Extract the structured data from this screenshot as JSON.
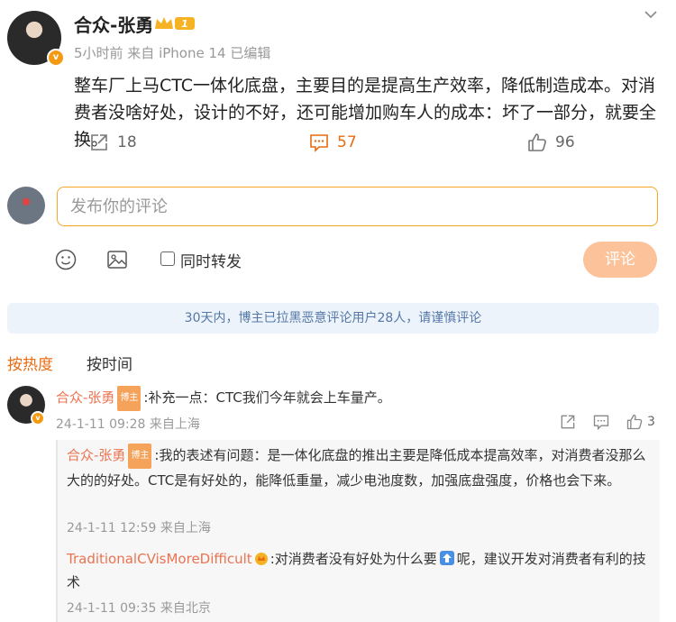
{
  "post": {
    "author": "合众-张勇",
    "level_badge": "1",
    "meta": "5小时前  来自 iPhone 14 已编辑",
    "text": "整车厂上马CTC一体化底盘，主要目的是提高生产效率，降低制造成本。对消费者没啥好处，设计的不好，还可能增加购车人的成本：坏了一部分，就要全换。",
    "shares": "18",
    "comments": "57",
    "likes": "96"
  },
  "composer": {
    "placeholder": "发布你的评论",
    "repost_label": "同时转发",
    "submit_label": "评论"
  },
  "notice": "30天内，博主已拉黑恶意评论用户28人，请谨慎评论",
  "sort": {
    "hot": "按热度",
    "time": "按时间"
  },
  "comment": {
    "name": "合众-张勇",
    "tag": "博主",
    "text": ":补充一点：CTC我们今年就会上车量产。",
    "meta": "24-1-11 09:28 来自上海",
    "likes": "3"
  },
  "replies": [
    {
      "name": "合众-张勇",
      "tag": "博主",
      "text": ":我的表述有问题：是一体化底盘的推出主要是降低成本提高效率，对消费者没那么大的的好处。CTC是有好处的，能降低重量，减少电池度数，加强底盘强度，价格也会下来。",
      "meta": "24-1-11 12:59 来自上海"
    },
    {
      "name": "TraditionalCVisMoreDifficult",
      "text_a": ":对消费者没有好处为什么要",
      "text_b": "呢，建议开发对消费者有利的技术",
      "meta": "24-1-11 09:35 来自北京"
    }
  ],
  "colors": {
    "accent": "#f5a623",
    "name": "#eb7350",
    "notice_text": "#5578a8"
  }
}
